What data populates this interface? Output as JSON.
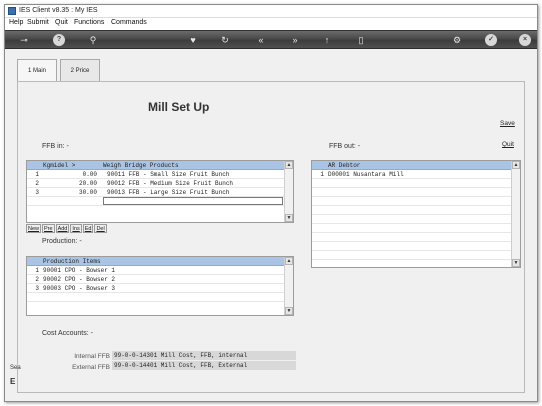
{
  "window": {
    "title": "IES Client v8.35 : My IES"
  },
  "menu": [
    "Help",
    "Submit",
    "Quit",
    "Functions",
    "Commands"
  ],
  "toolbar": {
    "icons": [
      "key-icon",
      "help-icon",
      "search-icon",
      "heart-icon",
      "refresh-icon",
      "rewind-icon",
      "fast-forward-icon",
      "upload-icon",
      "file-icon",
      "settings-icon",
      "check-icon",
      "close-icon"
    ]
  },
  "tabs": [
    {
      "label": "1 Main"
    },
    {
      "label": "2 Price"
    }
  ],
  "page": {
    "title": "Mill Set Up",
    "save": "Save",
    "quit": "Quit",
    "ffb_in": "FFB in: -",
    "ffb_out": "FFB out: -",
    "production": "Production: -",
    "cost_accounts": "Cost Accounts: -"
  },
  "ffb_in_grid": {
    "headers": [
      "Kgmidel >",
      "Weigh Bridge Products"
    ],
    "rows": [
      {
        "n": "1",
        "kg": "0.00",
        "product": "90011 FFB - Small Size Fruit Bunch"
      },
      {
        "n": "2",
        "kg": "20.00",
        "product": "90012 FFB - Medium Size Fruit Bunch"
      },
      {
        "n": "3",
        "kg": "30.00",
        "product": "90013 FFB - Large Size Fruit Bunch"
      }
    ]
  },
  "row_buttons": [
    "New",
    "Pre",
    "Add",
    "Ins",
    "Ed",
    "Del"
  ],
  "ffb_out_grid": {
    "header": "AR Debtor",
    "rows": [
      {
        "n": "1",
        "value": "D00001 Nusantara Mill"
      }
    ]
  },
  "production_grid": {
    "header": "Production Items",
    "rows": [
      {
        "n": "1",
        "value": "90001 CPO - Bowser 1"
      },
      {
        "n": "2",
        "value": "90002 CPO - Bowser 2"
      },
      {
        "n": "3",
        "value": "90003 CPO - Bowser 3"
      }
    ]
  },
  "cost": {
    "internal_label": "Internal FFB",
    "internal_value": "99-0-0-14301 Mill Cost, FFB, internal",
    "external_label": "External FFB",
    "external_value": "99-0-0-14401 Mill Cost, FFB, External"
  },
  "left_edge": {
    "text1": "Sea",
    "text2": "E"
  }
}
